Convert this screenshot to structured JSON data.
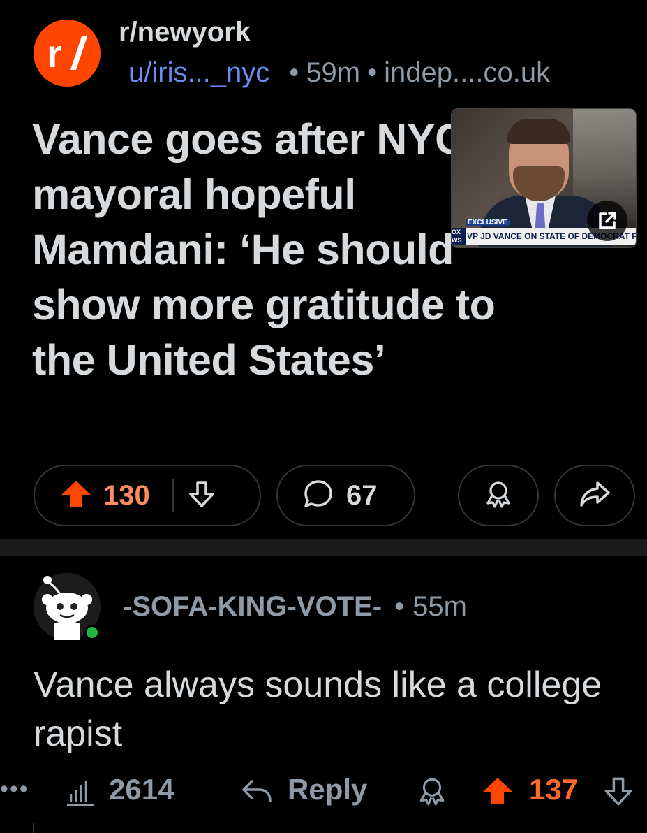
{
  "post": {
    "subreddit": "r/newyork",
    "author": "u/iris..._nyc",
    "age": "59m",
    "domain": "indep....co.uk",
    "title": "Vance goes after NYC mayoral hopeful Mamdani: ‘He should show more gratitude to the United States’",
    "thumbnail": {
      "badge": "EXCLUSIVE",
      "chyron": "VP JD VANCE ON STATE OF DEMOCRAT PARTY",
      "network": "OX WS"
    },
    "upvotes": "130",
    "comments": "67"
  },
  "comment": {
    "author": "-SOFA-KING-VOTE-",
    "age": "55m",
    "body": "Vance always sounds like a college rapist",
    "more": "•••",
    "stats": "2614",
    "reply_label": "Reply",
    "upvotes": "137"
  },
  "colors": {
    "upvote": "#ff4500",
    "upvote_count": "#ff8b60",
    "username_link": "#6a8ef2",
    "muted": "#8e9aa6",
    "online": "#1fb845"
  },
  "icons": [
    "subreddit-icon",
    "expand-icon",
    "upvote-icon",
    "downvote-icon",
    "comment-icon",
    "award-icon",
    "share-icon",
    "stats-icon",
    "reply-icon"
  ]
}
